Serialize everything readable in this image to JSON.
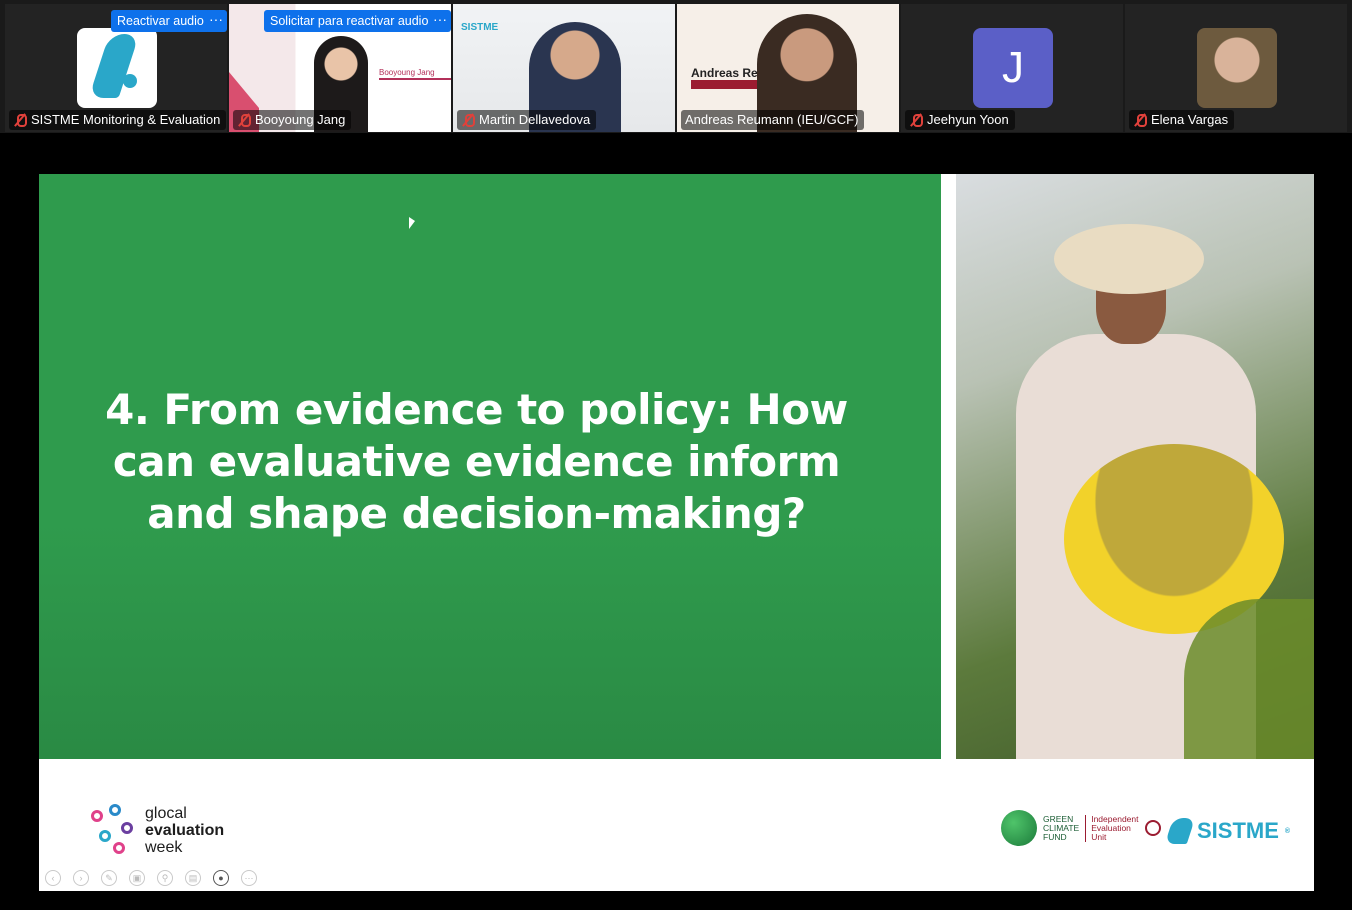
{
  "participants": [
    {
      "name": "SISTME Monitoring & Evaluation",
      "muted": true,
      "kind": "logo"
    },
    {
      "name": "Booyoung Jang",
      "muted": true,
      "kind": "video",
      "video_caption": "Booyoung Jang"
    },
    {
      "name": "Martin Dellavedova",
      "muted": true,
      "kind": "video",
      "video_brand": "SISTME"
    },
    {
      "name": "Andreas Reumann (IEU/GCF)",
      "muted": true,
      "kind": "video",
      "active_speaker": true,
      "video_caption": "Andreas Reum"
    },
    {
      "name": "Jeehyun Yoon",
      "muted": true,
      "kind": "initial",
      "initial": "J"
    },
    {
      "name": "Elena Vargas",
      "muted": true,
      "kind": "photo"
    }
  ],
  "controls": {
    "unmute_label": "Reactivar audio",
    "request_unmute_label": "Solicitar para reactivar audio",
    "more_label": "···"
  },
  "slide": {
    "title": "4. From evidence to policy: How can evaluative evidence inform and shape decision-making?",
    "footer": {
      "gew_line1": "glocal",
      "gew_line2": "evaluation",
      "gew_line3": "week",
      "gcf_line1": "GREEN",
      "gcf_line2": "CLIMATE",
      "gcf_line3": "FUND",
      "ieu_line1": "Independent",
      "ieu_line2": "Evaluation",
      "ieu_line3": "Unit",
      "sistme": "SISTME",
      "sistme_mark": "®"
    }
  },
  "colors": {
    "slide_green": "#2f9b4d",
    "active_speaker_border": "#2fd67a",
    "zoom_blue": "#0e71eb",
    "mute_red": "#e0413b",
    "sistme_blue": "#2aa7c9",
    "ieu_red": "#9b1c31"
  },
  "icons": [
    "mic-muted-icon",
    "more-options-icon",
    "mouse-cursor-icon",
    "slide-nav-prev-icon",
    "slide-nav-next-icon",
    "pen-icon",
    "copy-icon",
    "zoom-icon",
    "notes-icon",
    "camera-icon",
    "more-icon"
  ]
}
